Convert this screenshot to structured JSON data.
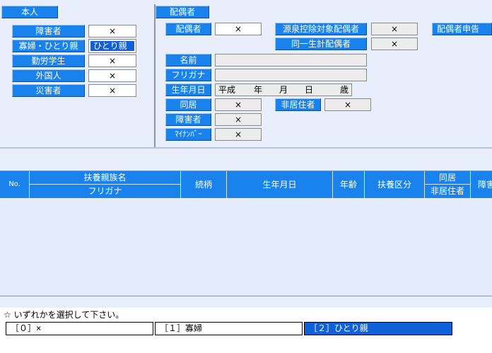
{
  "honnin": {
    "title": "本人",
    "rows": [
      {
        "label": "障害者",
        "value": "×"
      },
      {
        "label": "寡婦・ひとり親",
        "value": "ひとり親"
      },
      {
        "label": "勤労学生",
        "value": "×"
      },
      {
        "label": "外国人",
        "value": "×"
      },
      {
        "label": "災害者",
        "value": "×"
      }
    ]
  },
  "spouse": {
    "title": "配偶者",
    "spouse_label": "配偶者",
    "spouse_value": "×",
    "gensen_label": "源泉控除対象配偶者",
    "gensen_value": "×",
    "shinkoku_label": "配偶者申告",
    "seikei_label": "同一生計配偶者",
    "seikei_value": "×",
    "name_label": "名前",
    "name_value": "",
    "furigana_label": "フリガナ",
    "furigana_value": "",
    "birth_label": "生年月日",
    "birth_era": "平成",
    "birth_year_unit": "年",
    "birth_month_unit": "月",
    "birth_day_unit": "日",
    "birth_age_unit": "歳",
    "dokyo_label": "同居",
    "dokyo_value": "×",
    "hikyoju_label": "非居住者",
    "hikyoju_value": "×",
    "shogai_label": "障害者",
    "shogai_value": "×",
    "mynumber_label": "ﾏｲﾅﾝﾊﾞｰ",
    "mynumber_value": "×"
  },
  "table": {
    "no": "No.",
    "name": "扶養親族名",
    "furigana": "フリガナ",
    "relation": "続柄",
    "birth": "生年月日",
    "age": "年齢",
    "category": "扶養区分",
    "dokyo": "同居",
    "hikyoju": "非居住者",
    "shogai": "障害"
  },
  "footer": {
    "prompt": "☆ いずれかを選択して下さい。",
    "options": [
      "［０］×",
      "［１］寡婦",
      "［２］ひとり親"
    ]
  }
}
